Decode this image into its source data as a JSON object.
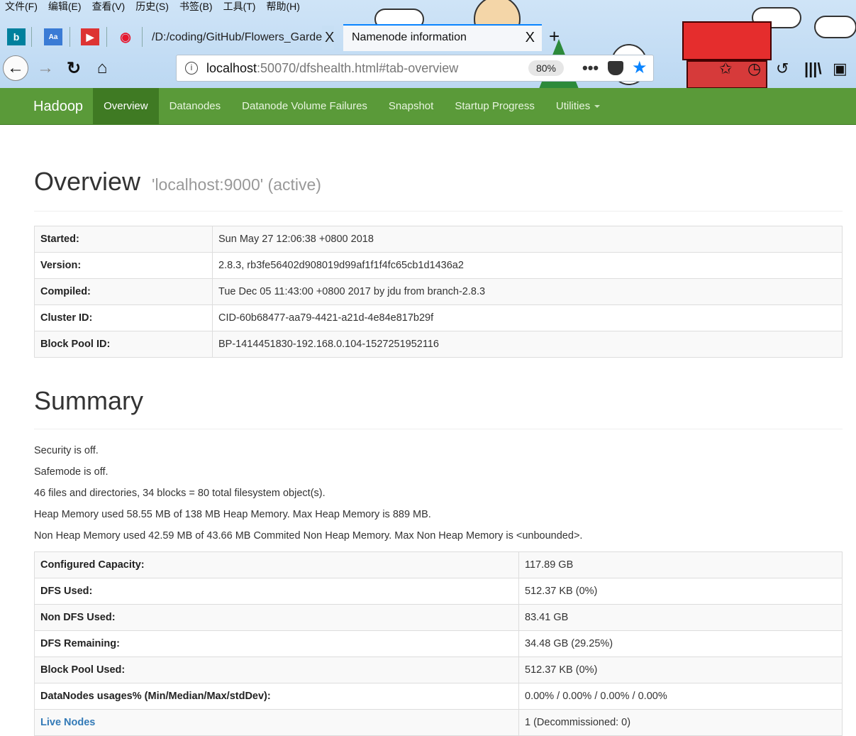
{
  "browser": {
    "menu": [
      "文件(F)",
      "编辑(E)",
      "查看(V)",
      "历史(S)",
      "书签(B)",
      "工具(T)",
      "帮助(H)"
    ],
    "tabs": {
      "pinned_icons": [
        "bing-icon",
        "dictionary-icon",
        "video-icon",
        "weibo-icon"
      ],
      "file_tab_title": "/D:/coding/GitHub/Flowers_Garden",
      "active_tab_title": "Namenode information",
      "close_glyph": "X",
      "new_tab_glyph": "+"
    },
    "url": {
      "host": "localhost",
      "rest": ":50070/dfshealth.html#tab-overview",
      "zoom": "80%"
    },
    "accent_color": "#0a84ff"
  },
  "hadoop_nav": {
    "brand": "Hadoop",
    "items": [
      "Overview",
      "Datanodes",
      "Datanode Volume Failures",
      "Snapshot",
      "Startup Progress",
      "Utilities"
    ],
    "active_index": 0,
    "bar_color": "#5a9a39"
  },
  "overview": {
    "title": "Overview",
    "subtitle": "'localhost:9000' (active)",
    "rows": [
      {
        "key": "Started:",
        "value": "Sun May 27 12:06:38 +0800 2018"
      },
      {
        "key": "Version:",
        "value": "2.8.3, rb3fe56402d908019d99af1f1f4fc65cb1d1436a2"
      },
      {
        "key": "Compiled:",
        "value": "Tue Dec 05 11:43:00 +0800 2017 by jdu from branch-2.8.3"
      },
      {
        "key": "Cluster ID:",
        "value": "CID-60b68477-aa79-4421-a21d-4e84e817b29f"
      },
      {
        "key": "Block Pool ID:",
        "value": "BP-1414451830-192.168.0.104-1527251952116"
      }
    ]
  },
  "summary": {
    "title": "Summary",
    "messages": [
      "Security is off.",
      "Safemode is off.",
      "46 files and directories, 34 blocks = 80 total filesystem object(s).",
      "Heap Memory used 58.55 MB of 138 MB Heap Memory. Max Heap Memory is 889 MB.",
      "Non Heap Memory used 42.59 MB of 43.66 MB Commited Non Heap Memory. Max Non Heap Memory is <unbounded>."
    ],
    "rows": [
      {
        "key": "Configured Capacity:",
        "value": "117.89 GB"
      },
      {
        "key": "DFS Used:",
        "value": "512.37 KB (0%)"
      },
      {
        "key": "Non DFS Used:",
        "value": "83.41 GB"
      },
      {
        "key": "DFS Remaining:",
        "value": "34.48 GB (29.25%)"
      },
      {
        "key": "Block Pool Used:",
        "value": "512.37 KB (0%)"
      },
      {
        "key": "DataNodes usages% (Min/Median/Max/stdDev):",
        "value": "0.00% / 0.00% / 0.00% / 0.00%"
      },
      {
        "key": "Live Nodes",
        "value": "1 (Decommissioned: 0)",
        "link": true
      }
    ]
  }
}
